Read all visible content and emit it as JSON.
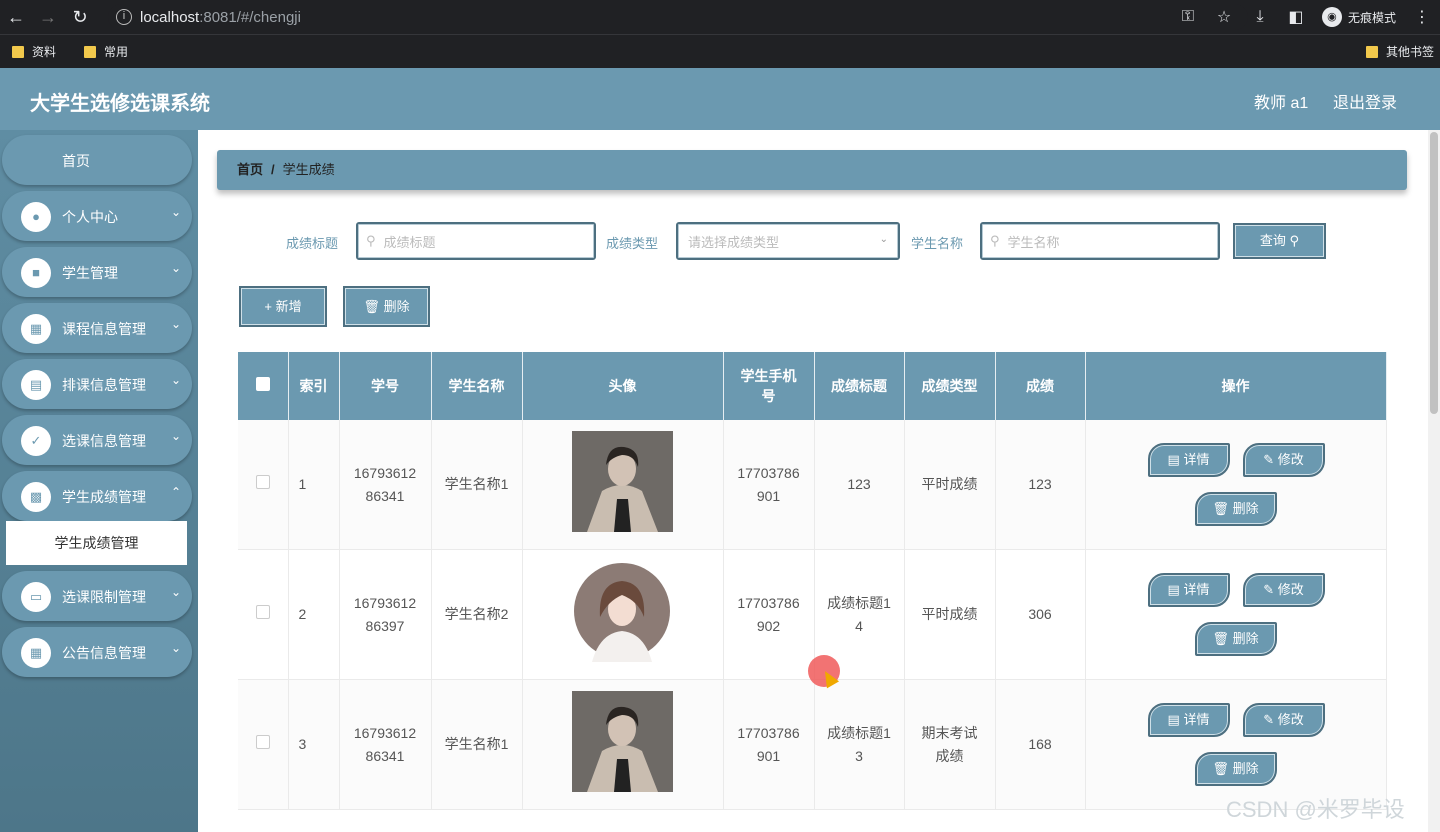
{
  "browser": {
    "url_host": "localhost",
    "url_path": ":8081/#/chengji",
    "incognito_label": "无痕模式",
    "bookmarks": [
      "资料",
      "常用"
    ],
    "other_bookmarks": "其他书签"
  },
  "header": {
    "title": "大学生选修选课系统",
    "user": "教师 a1",
    "logout": "退出登录"
  },
  "sidebar": {
    "items": [
      {
        "label": "首页"
      },
      {
        "label": "个人中心"
      },
      {
        "label": "学生管理"
      },
      {
        "label": "课程信息管理"
      },
      {
        "label": "排课信息管理"
      },
      {
        "label": "选课信息管理"
      },
      {
        "label": "学生成绩管理"
      },
      {
        "label": "选课限制管理"
      },
      {
        "label": "公告信息管理"
      }
    ],
    "active_sub": "学生成绩管理"
  },
  "breadcrumb": {
    "home": "首页",
    "sep": "/",
    "current": "学生成绩"
  },
  "filters": {
    "title_label": "成绩标题",
    "title_placeholder": "成绩标题",
    "type_label": "成绩类型",
    "type_placeholder": "请选择成绩类型",
    "student_label": "学生名称",
    "student_placeholder": "学生名称",
    "search_button": "查询"
  },
  "actions": {
    "add": "新增",
    "delete": "删除"
  },
  "table": {
    "headers": [
      "索引",
      "学号",
      "学生名称",
      "头像",
      "学生手机号",
      "成绩标题",
      "成绩类型",
      "成绩",
      "操作"
    ],
    "rows": [
      {
        "index": "1",
        "student_no": "1679361286341",
        "name": "学生名称1",
        "phone": "17703786901",
        "title": "123",
        "type": "平时成绩",
        "score": "123",
        "avatar": "male-photo"
      },
      {
        "index": "2",
        "student_no": "1679361286397",
        "name": "学生名称2",
        "phone": "17703786902",
        "title": "成绩标题14",
        "type": "平时成绩",
        "score": "306",
        "avatar": "female-illustration"
      },
      {
        "index": "3",
        "student_no": "1679361286341",
        "name": "学生名称1",
        "phone": "17703786901",
        "title": "成绩标题13",
        "type": "期末考试成绩",
        "score": "168",
        "avatar": "male-photo"
      }
    ],
    "row_buttons": {
      "detail": "详情",
      "edit": "修改",
      "delete": "删除"
    }
  },
  "watermark": "CSDN @米罗毕设"
}
